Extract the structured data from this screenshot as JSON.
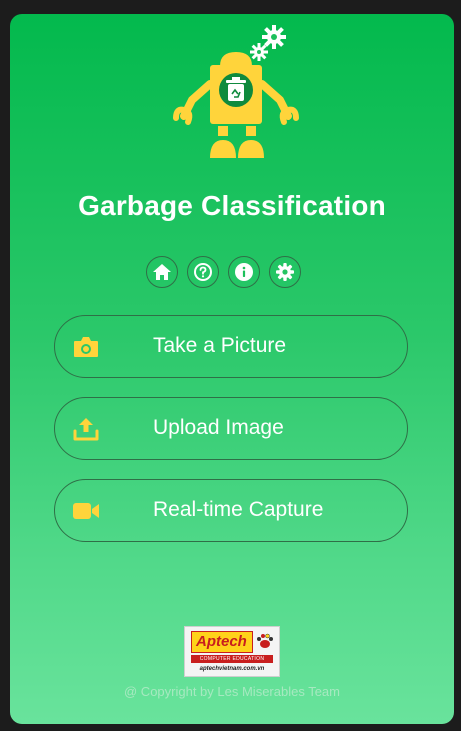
{
  "app": {
    "title": "Garbage Classification"
  },
  "nav_icons": [
    {
      "name": "home-icon"
    },
    {
      "name": "help-icon"
    },
    {
      "name": "info-icon"
    },
    {
      "name": "settings-icon"
    }
  ],
  "actions": [
    {
      "label": "Take a Picture",
      "icon": "camera-icon"
    },
    {
      "label": "Upload Image",
      "icon": "upload-icon"
    },
    {
      "label": "Real-time Capture",
      "icon": "video-camera-icon"
    }
  ],
  "logo": {
    "brand": "Aptech",
    "tagline": "COMPUTER EDUCATION",
    "website": "aptechvietnam.com.vn"
  },
  "footer": {
    "copyright": "@ Copyright by Les Miserables Team"
  },
  "colors": {
    "gradient_top": "#03b94d",
    "gradient_bottom": "#69e39c",
    "accent_yellow": "#ffd43b",
    "icon_green": "#0f8a3d",
    "outline": "#2f6f47"
  }
}
